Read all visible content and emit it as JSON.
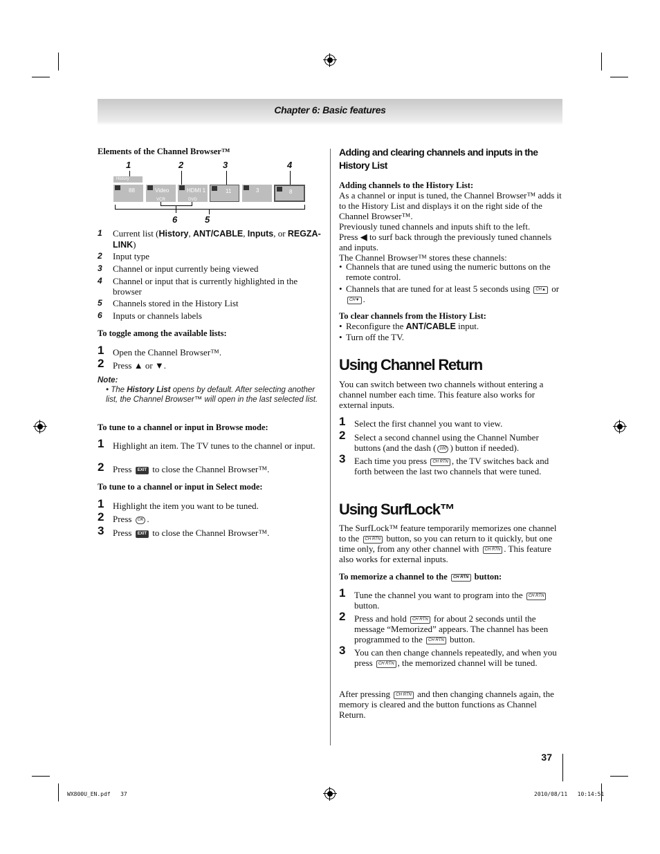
{
  "header": {
    "chapter": "Chapter 6: Basic features"
  },
  "left": {
    "elements_heading": "Elements of the Channel Browser™",
    "diagram": {
      "callouts": [
        "1",
        "2",
        "3",
        "4",
        "6",
        "5"
      ],
      "list_label": "History",
      "tiles": [
        {
          "icon": "antenna-icon",
          "title": "88",
          "sub": ""
        },
        {
          "icon": "video-input-icon",
          "title": "Video",
          "sub": "VCR"
        },
        {
          "icon": "hdmi-input-icon",
          "title": "HDMI 1",
          "sub": "DVD"
        },
        {
          "icon": "antenna-icon",
          "title": "11",
          "sub": "",
          "current": true
        },
        {
          "icon": "antenna-icon",
          "title": "3",
          "sub": ""
        },
        {
          "icon": "antenna-icon",
          "title": "8",
          "sub": "",
          "highlighted": true
        }
      ]
    },
    "legend": [
      {
        "n": "1",
        "pre": "Current list (",
        "b1": "History",
        "s1": ", ",
        "b2": "ANT/CABLE",
        "s2": ", ",
        "b3": "Inputs",
        "s3": ", or ",
        "b4": "REGZA-LINK",
        "post": ")"
      },
      {
        "n": "2",
        "text": "Input type"
      },
      {
        "n": "3",
        "text": "Channel or input currently being viewed"
      },
      {
        "n": "4",
        "text": "Channel or input that is currently highlighted in the browser"
      },
      {
        "n": "5",
        "text": "Channels stored in the History List"
      },
      {
        "n": "6",
        "text": "Inputs or channels labels"
      }
    ],
    "toggle_heading": "To toggle among the available lists:",
    "toggle_steps": [
      "Open the Channel Browser™.",
      "Press ▲ or ▼."
    ],
    "note_label": "Note:",
    "note": {
      "pre": "The ",
      "bold": "History List",
      "post": " opens by default. After selecting another list, the Channel Browser™ will open in the last selected list."
    },
    "browse_heading": "To tune to a channel or input in Browse mode:",
    "browse_steps": [
      {
        "text": "Highlight an item. The TV tunes to the channel or input."
      },
      {
        "pre": "Press ",
        "icon": "EXIT",
        "post": " to close the Channel Browser™."
      }
    ],
    "select_heading": "To tune to a channel or input in Select mode:",
    "select_steps": [
      {
        "text": "Highlight the item you want to be tuned."
      },
      {
        "pre": "Press ",
        "icon": "OK",
        "post": "."
      },
      {
        "pre": "Press ",
        "icon": "EXIT",
        "post": " to close the Channel Browser™."
      }
    ]
  },
  "right": {
    "heading": "Adding and clearing channels and inputs in the History List",
    "adding_heading": "Adding channels to the History List:",
    "adding_p1": "As a channel or input is tuned, the Channel Browser™ adds it to the History List and displays it on the right side of the Channel Browser™.",
    "adding_p2": "Previously tuned channels and inputs shift to the left.",
    "adding_p3": "Press ◀ to surf back through the previously tuned channels and inputs.",
    "adding_p4": "The Channel Browser™ stores these channels:",
    "bullet1": "Channels that are tuned using the numeric buttons on the remote control.",
    "bullet2_pre": "Channels that are tuned for at least 5 seconds using ",
    "bullet2_mid": " or ",
    "bullet2_post": ".",
    "icon_ch_up": "CH▲",
    "icon_ch_down": "CH▼",
    "clear_heading": "To clear channels from the History List:",
    "clear_b1_pre": "Reconfigure the ",
    "clear_b1_bold": "ANT/CABLE",
    "clear_b1_post": " input.",
    "clear_b2": "Turn off the TV.",
    "cr_title": "Using Channel Return",
    "cr_p": "You can switch between two channels without entering a channel number each time. This feature also works for external inputs.",
    "cr_s1": "Select the first channel you want to view.",
    "cr_s2_pre": "Select a second channel using the Channel Number buttons (and the dash (",
    "cr_s2_icon": "100",
    "cr_s2_post": ") button if needed).",
    "cr_s3_pre": "Each time you press ",
    "cr_s3_post": ", the TV switches back and forth between the last two channels that were tuned.",
    "icon_chrtn": "CH RTN",
    "sl_title": "Using SurfLock™",
    "sl_p_a": "The SurfLock™ feature temporarily memorizes one channel to the ",
    "sl_p_b": " button, so you can return to it quickly, but one time only, from any other channel with ",
    "sl_p_c": ". This feature also works for external inputs.",
    "mem_heading_pre": "To memorize a channel to the ",
    "mem_heading_post": " button:",
    "mem_s1_pre": "Tune the channel you want to program into the ",
    "mem_s1_post": " button.",
    "mem_s2_pre": "Press and hold ",
    "mem_s2_post": " for about 2 seconds until the message “Memorized” appears. The channel has been programmed to the ",
    "mem_s2_post2": " button.",
    "mem_s3_pre": "You can then change channels repeatedly, and when you press ",
    "mem_s3_post": ", the memorized channel will be tuned.",
    "after_pre": "After pressing ",
    "after_post": " and then changing channels again, the memory is cleared and the button functions as Channel Return."
  },
  "page_number": "37",
  "footer": {
    "file": "WX800U_EN.pdf",
    "page": "37",
    "date": "2010/08/11",
    "time": "10:14:51"
  }
}
